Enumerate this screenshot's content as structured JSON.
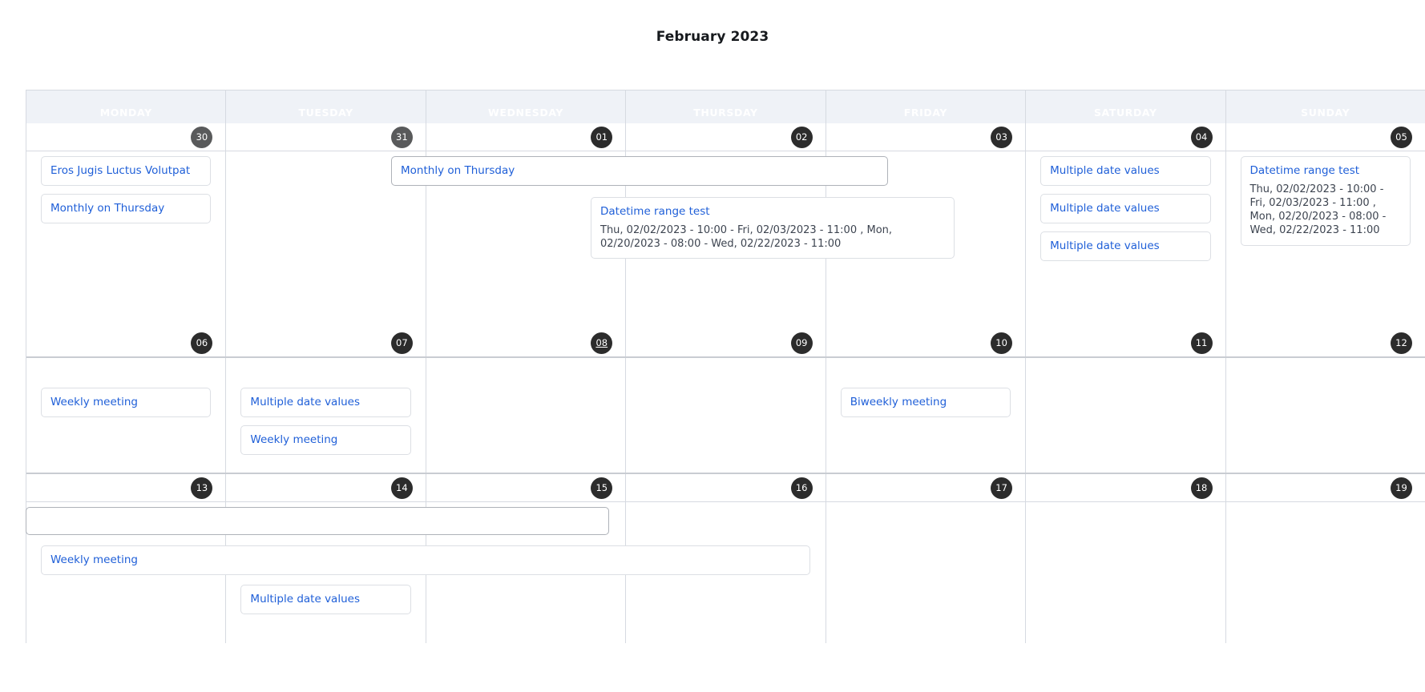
{
  "title": "February 2023",
  "weekdays": [
    "MONDAY",
    "TUESDAY",
    "WEDNESDAY",
    "THURSDAY",
    "FRIDAY",
    "SATURDAY",
    "SUNDAY"
  ],
  "colors": {
    "event_link": "#1f5fd8",
    "header_bg": "#eff2f7",
    "header_text": "#ffffff",
    "badge_past": "#595a5b",
    "badge_current": "#2c2c2c",
    "row_tint_past": "#f1f1f1",
    "row_tint_highlight": "#f4f7fe",
    "grid_border": "#d6dae1"
  },
  "events": {
    "eros": "Eros Jugis Luctus Volutpat",
    "monthly": "Monthly on Thursday",
    "datetime_range_title": "Datetime range test",
    "datetime_range_detail": "Thu, 02/02/2023 - 10:00 - Fri, 02/03/2023 - 11:00 , Mon, 02/20/2023 - 08:00 - Wed, 02/22/2023 - 11:00",
    "multiple": "Multiple date values",
    "weekly": "Weekly meeting",
    "biweekly": "Biweekly meeting"
  },
  "weeks": [
    {
      "dates": [
        {
          "label": "30",
          "style": "past"
        },
        {
          "label": "31",
          "style": "past"
        },
        {
          "label": "01",
          "style": "current"
        },
        {
          "label": "02",
          "style": "current"
        },
        {
          "label": "03",
          "style": "current"
        },
        {
          "label": "04",
          "style": "current"
        },
        {
          "label": "05",
          "style": "current"
        }
      ]
    },
    {
      "dates": [
        {
          "label": "06",
          "style": "current"
        },
        {
          "label": "07",
          "style": "current"
        },
        {
          "label": "08",
          "style": "today"
        },
        {
          "label": "09",
          "style": "current"
        },
        {
          "label": "10",
          "style": "current"
        },
        {
          "label": "11",
          "style": "current"
        },
        {
          "label": "12",
          "style": "current"
        }
      ]
    },
    {
      "dates": [
        {
          "label": "13",
          "style": "current"
        },
        {
          "label": "14",
          "style": "current"
        },
        {
          "label": "15",
          "style": "current"
        },
        {
          "label": "16",
          "style": "current"
        },
        {
          "label": "17",
          "style": "current"
        },
        {
          "label": "18",
          "style": "current"
        },
        {
          "label": "19",
          "style": "current"
        }
      ]
    }
  ]
}
